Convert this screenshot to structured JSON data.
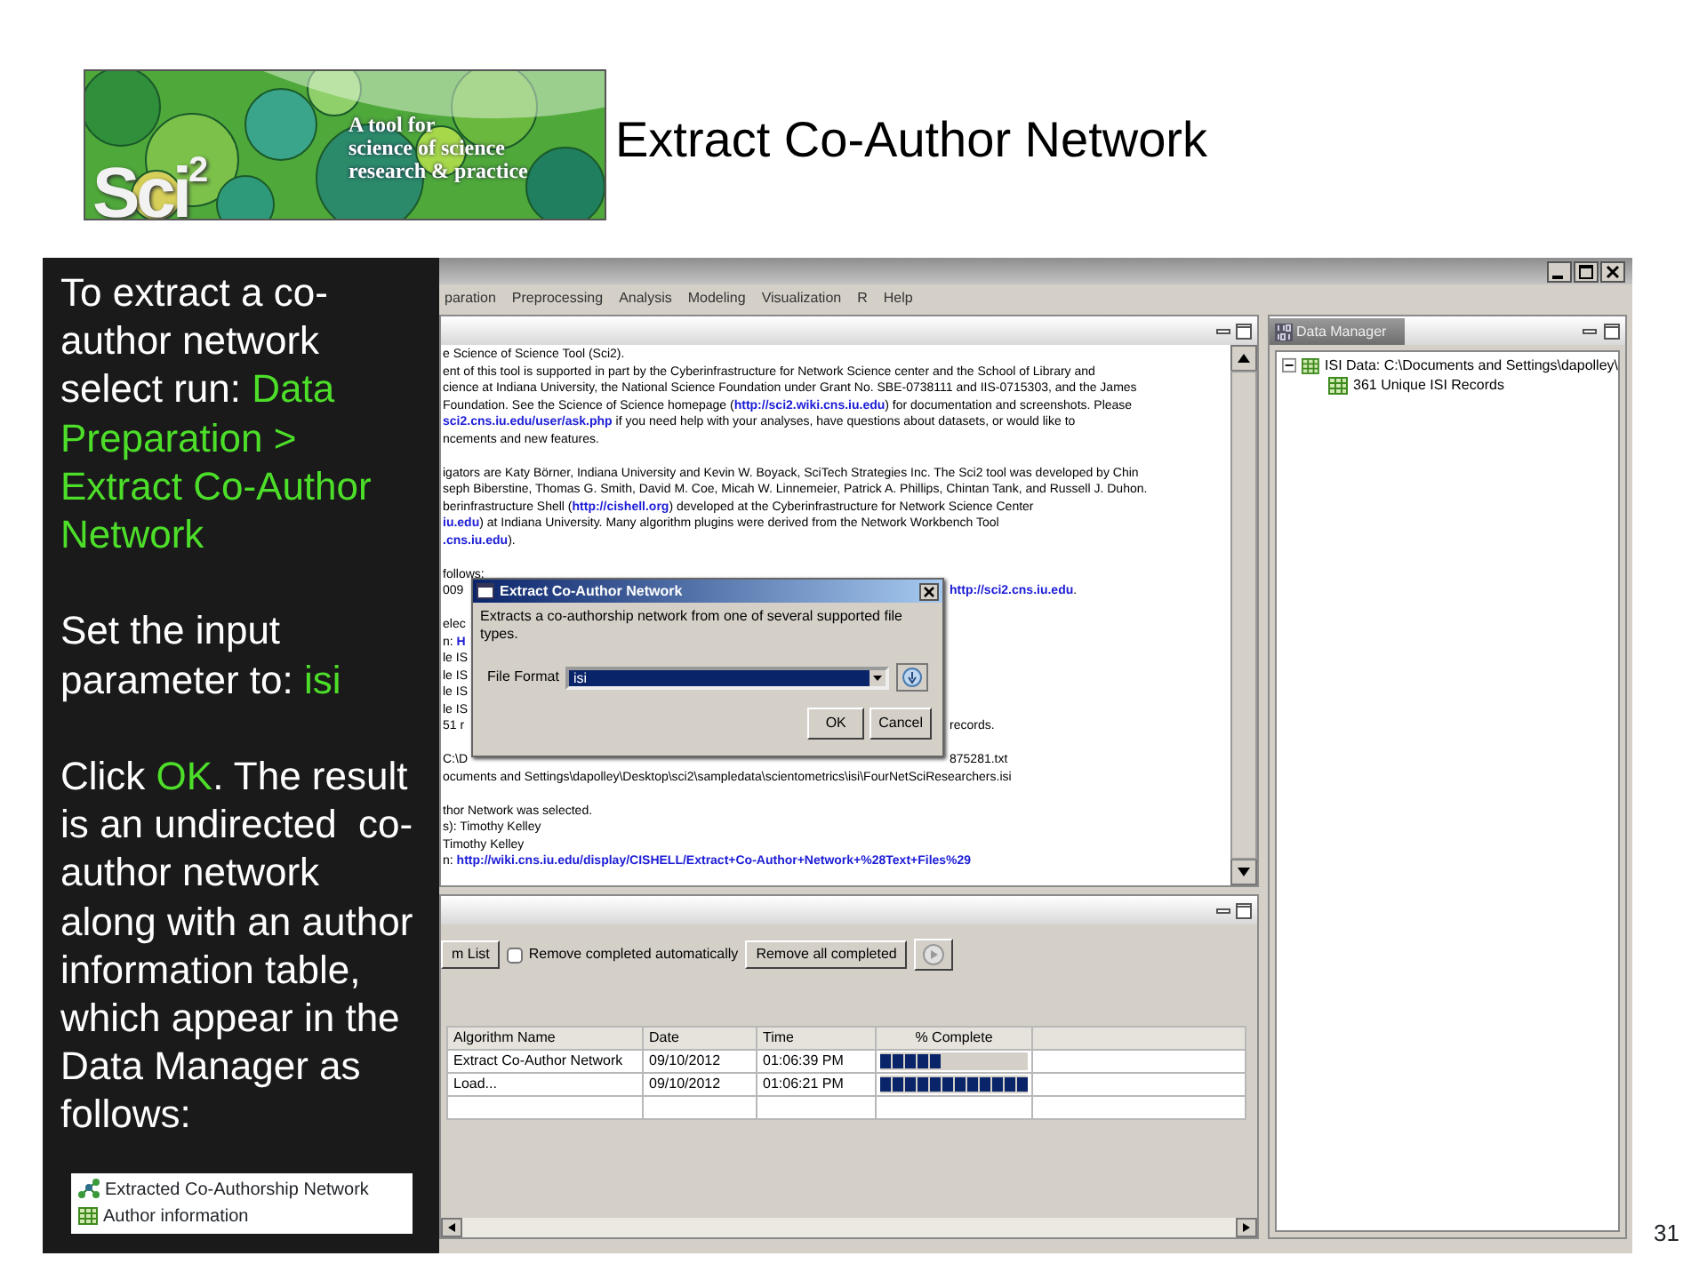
{
  "logo": {
    "tagline": [
      "A tool for",
      "science of science",
      "research & practice"
    ],
    "wordmark": "Sci",
    "superscript": "2"
  },
  "slide_title": "Extract Co-Author Network",
  "instructions": [
    {
      "segments": [
        {
          "text": "To extract a co-author network select run: ",
          "highlight": false
        },
        {
          "text": "Data Preparation > Extract Co-Author Network",
          "highlight": true
        }
      ]
    },
    {
      "segments": [
        {
          "text": "Set the input parameter to: ",
          "highlight": false
        },
        {
          "text": "isi",
          "highlight": true
        }
      ]
    },
    {
      "segments": [
        {
          "text": "Click ",
          "highlight": false
        },
        {
          "text": "OK",
          "highlight": true
        },
        {
          "text": ". The result is an undirected  co-author network along with an author information table, which appear in the Data Manager as follows:",
          "highlight": false
        }
      ]
    }
  ],
  "preview_items": [
    {
      "label": "Extracted Co-Authorship Network",
      "kind": "network"
    },
    {
      "label": "Author information",
      "kind": "table"
    }
  ],
  "app": {
    "menu": [
      "paration",
      "Preprocessing",
      "Analysis",
      "Modeling",
      "Visualization",
      "R",
      "Help"
    ],
    "console": [
      {
        "kind": "text",
        "text": "e Science of Science Tool (Sci2)."
      },
      {
        "kind": "text",
        "text": "ent of this tool is supported in part by the Cyberinfrastructure for Network Science center and the School of Library and"
      },
      {
        "kind": "text",
        "text": "cience at Indiana University, the National Science Foundation under Grant No. SBE-0738111 and IIS-0715303, and the James"
      },
      {
        "kind": "text",
        "text": "Foundation. See the Science of Science homepage (**http://sci2.wiki.cns.iu.edu**) for documentation and screenshots. Please"
      },
      {
        "kind": "text",
        "text": "**sci2.cns.iu.edu/user/ask.php** if you need help with your analyses, have questions about datasets, or would like to"
      },
      {
        "kind": "text",
        "text": "ncements and new features."
      },
      {
        "kind": "blank"
      },
      {
        "kind": "text",
        "text": "igators are Katy Börner, Indiana University and Kevin W. Boyack, SciTech Strategies Inc. The Sci2 tool was developed by Chin"
      },
      {
        "kind": "text",
        "text": "seph Biberstine, Thomas G. Smith, David M. Coe, Micah W. Linnemeier, Patrick A. Phillips, Chintan Tank, and Russell J. Duhon."
      },
      {
        "kind": "text",
        "text": "berinfrastructure Shell (**http://cishell.org**) developed at the Cyberinfrastructure for Network Science Center"
      },
      {
        "kind": "text",
        "text": "**iu.edu**) at Indiana University. Many algorithm plugins were derived from the Network Workbench Tool"
      },
      {
        "kind": "text",
        "text": "**.cns.iu.edu**)."
      },
      {
        "kind": "blank"
      },
      {
        "kind": "text",
        "text": "follows:"
      },
      {
        "kind": "text",
        "text": "009",
        "tail": "**http://sci2.cns.iu.edu**."
      },
      {
        "kind": "blank"
      },
      {
        "kind": "text",
        "text": "elec"
      },
      {
        "kind": "text",
        "text": "n: **H**"
      },
      {
        "kind": "text",
        "text": "le IS"
      },
      {
        "kind": "text",
        "text": "le IS"
      },
      {
        "kind": "text",
        "text": "le IS"
      },
      {
        "kind": "text",
        "text": "le IS"
      },
      {
        "kind": "text",
        "text": "51 r",
        "tail": "records."
      },
      {
        "kind": "blank"
      },
      {
        "kind": "text",
        "text": "C:\\D",
        "tail": "875281.txt"
      },
      {
        "kind": "text",
        "text": "ocuments and Settings\\dapolley\\Desktop\\sci2\\sampledata\\scientometrics\\isi\\FourNetSciResearchers.isi"
      },
      {
        "kind": "blank"
      },
      {
        "kind": "text",
        "text": "thor Network was selected."
      },
      {
        "kind": "text",
        "text": "s): Timothy Kelley"
      },
      {
        "kind": "text",
        "text": " Timothy Kelley"
      },
      {
        "kind": "text",
        "text": "n: **http://wiki.cns.iu.edu/display/CISHELL/Extract+Co-Author+Network+%28Text+Files%29**"
      }
    ],
    "dialog": {
      "title": "Extract Co-Author Network",
      "description": "Extracts a co-authorship network from one of several supported file types.",
      "field_label": "File Format",
      "field_value": "isi",
      "buttons": [
        "OK",
        "Cancel"
      ]
    },
    "scheduler": {
      "list_button": "m List",
      "checkbox": {
        "label": "Remove completed automatically",
        "checked": false
      },
      "remove_button": "Remove all completed",
      "columns": [
        "Algorithm Name",
        "Date",
        "Time",
        "% Complete"
      ],
      "rows": [
        {
          "name": "Extract Co-Author Network",
          "date": "09/10/2012",
          "time": "01:06:39 PM",
          "level": 0.42
        },
        {
          "name": "Load...",
          "date": "09/10/2012",
          "time": "01:06:21 PM",
          "level": 1
        }
      ]
    },
    "data_manager": {
      "title": "Data Manager",
      "tree": [
        {
          "label": "ISI Data: C:\\Documents and Settings\\dapolley\\",
          "expanded": true,
          "children": [
            {
              "label": "361 Unique ISI Records"
            }
          ]
        }
      ]
    }
  },
  "page_number": "31"
}
